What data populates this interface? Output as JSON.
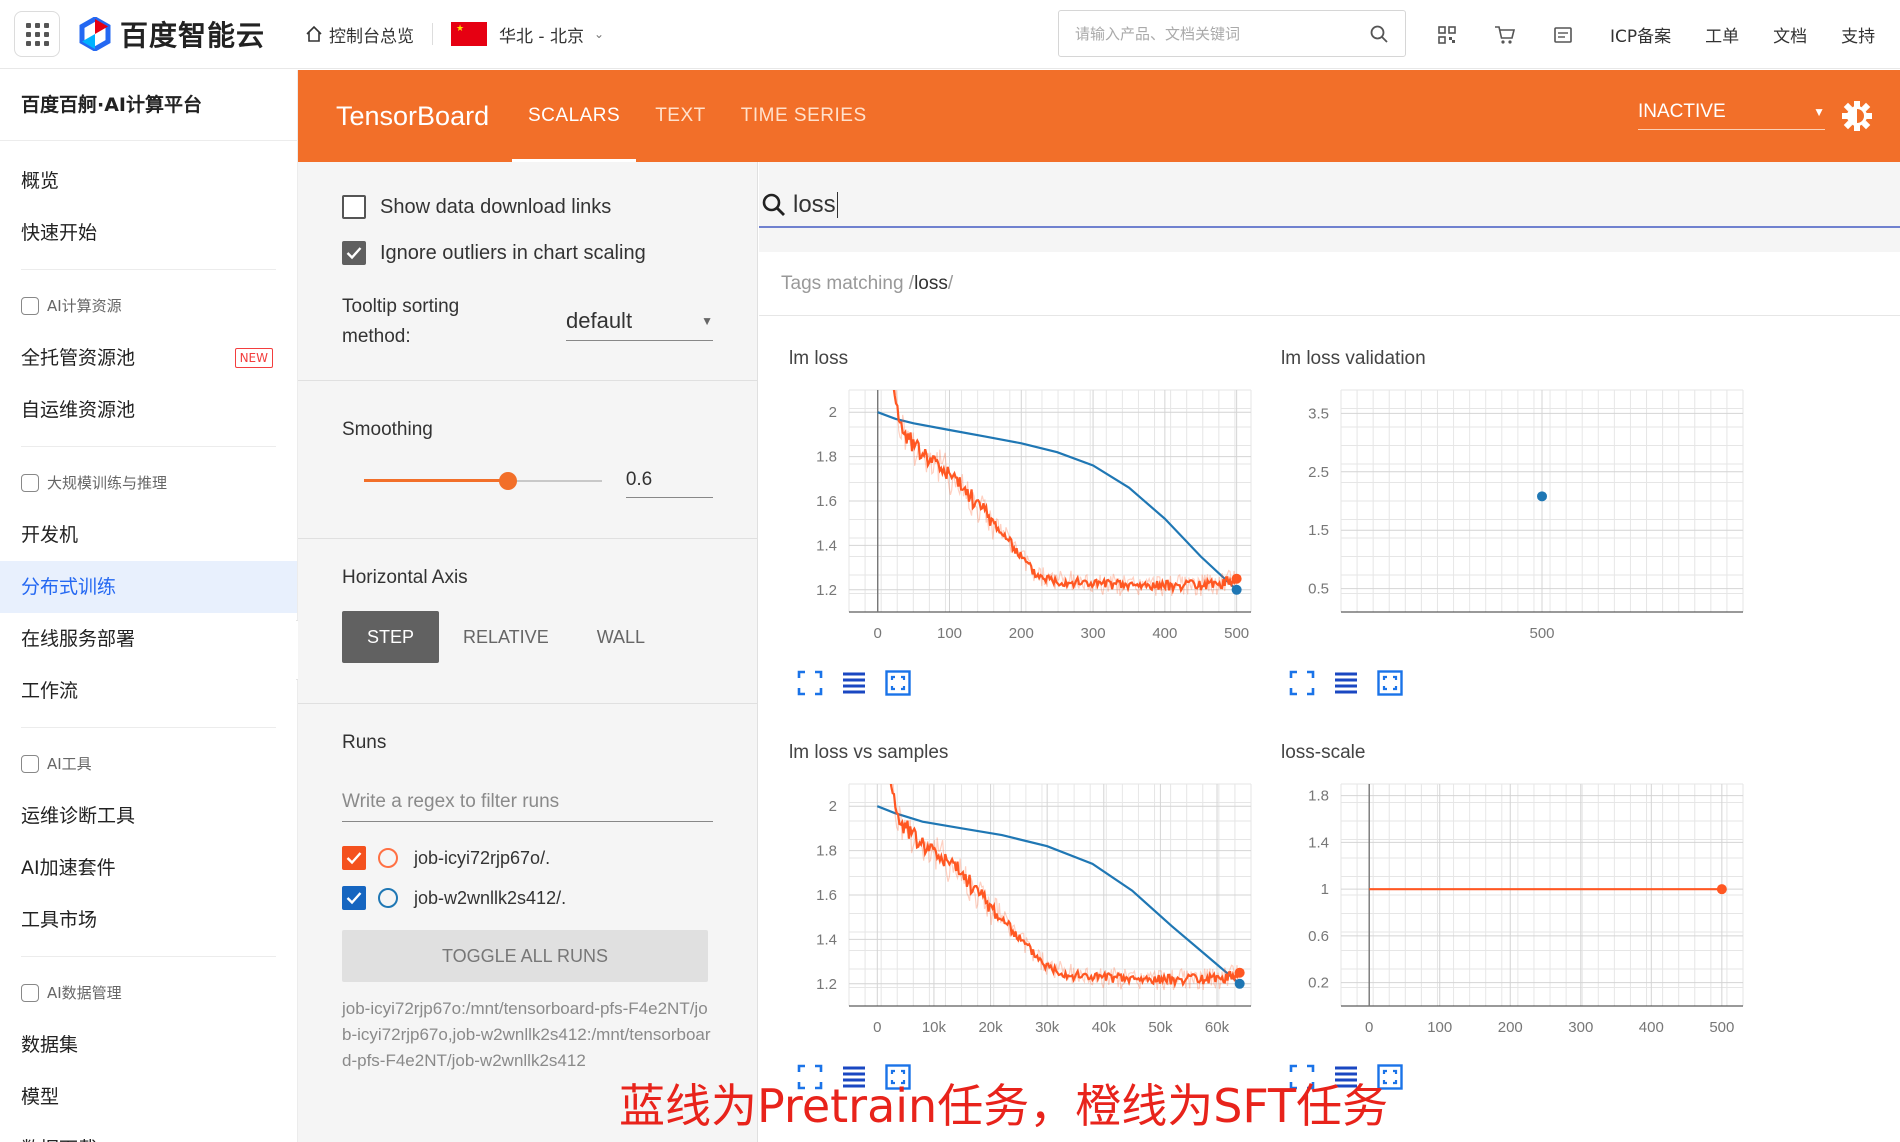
{
  "topbar": {
    "brand": "百度智能云",
    "console": "控制台总览",
    "region": "华北 - 北京",
    "search_placeholder": "请输入产品、文档关键词",
    "links": [
      "ICP备案",
      "工单",
      "文档",
      "支持"
    ],
    "icons": [
      "qrcode-icon",
      "cart-icon",
      "message-icon"
    ]
  },
  "sidebar": {
    "title": "百度百舸·AI计算平台",
    "items_top": [
      "概览",
      "快速开始"
    ],
    "group1": "AI计算资源",
    "group1_items": [
      "全托管资源池",
      "自运维资源池"
    ],
    "new_badge": "NEW",
    "group2": "大规模训练与推理",
    "group2_items": [
      "开发机",
      "分布式训练",
      "在线服务部署",
      "工作流"
    ],
    "active": "分布式训练",
    "group3": "AI工具",
    "group3_items": [
      "运维诊断工具",
      "AI加速套件",
      "工具市场"
    ],
    "group4": "AI数据管理",
    "group4_items": [
      "数据集",
      "模型",
      "数据下载"
    ]
  },
  "tensorboard": {
    "logo": "TensorBoard",
    "tabs": [
      "SCALARS",
      "TEXT",
      "TIME SERIES"
    ],
    "active_tab": "SCALARS",
    "status": "INACTIVE"
  },
  "settings": {
    "show_download_links": "Show data download links",
    "show_download_links_checked": false,
    "ignore_outliers": "Ignore outliers in chart scaling",
    "ignore_outliers_checked": true,
    "tooltip_sorting_label": "Tooltip sorting method:",
    "tooltip_sorting_value": "default",
    "smoothing_label": "Smoothing",
    "smoothing_value": "0.6",
    "smoothing_fraction": 0.6,
    "horizontal_axis_label": "Horizontal Axis",
    "axis_options": [
      "STEP",
      "RELATIVE",
      "WALL"
    ],
    "axis_active": "STEP",
    "runs_label": "Runs",
    "runs_filter_placeholder": "Write a regex to filter runs",
    "runs": [
      {
        "name": "job-icyi72rjp67o/.",
        "color": "#ff7043",
        "checked": true
      },
      {
        "name": "job-w2wnllk2s412/.",
        "color": "#1f77b4",
        "checked": true
      }
    ],
    "toggle_all": "TOGGLE ALL RUNS",
    "run_paths": "job-icyi72rjp67o:/mnt/tensorboard-pfs-F4e2NT/job-icyi72rjp67o,job-w2wnllk2s412:/mnt/tensorboard-pfs-F4e2NT/job-w2wnllk2s412"
  },
  "main": {
    "filter_value": "loss",
    "tags_prefix": "Tags matching /",
    "tags_match": "loss",
    "tags_suffix": "/"
  },
  "colors": {
    "accent": "#f26f29",
    "pretrain": "#1f77b4",
    "sft": "#ff5722"
  },
  "caption": "蓝线为Pretrain任务，橙线为SFT任务",
  "chart_data": [
    {
      "id": "lm-loss",
      "type": "line",
      "title": "lm loss",
      "xlim": [
        -40,
        520
      ],
      "ylim": [
        1.1,
        2.1
      ],
      "xticks": [
        0,
        100,
        200,
        300,
        400,
        500
      ],
      "yticks": [
        1.2,
        1.4,
        1.6,
        1.8,
        2
      ],
      "ytick_labels": [
        "1.2",
        "1.4",
        "1.6",
        "1.8",
        "2"
      ],
      "vline": 0,
      "series": [
        {
          "name": "job-w2wnllk2s412/.",
          "color": "#1f77b4",
          "x": [
            0,
            25,
            50,
            100,
            150,
            200,
            250,
            300,
            350,
            400,
            450,
            500
          ],
          "y": [
            2.0,
            1.97,
            1.95,
            1.92,
            1.89,
            1.86,
            1.82,
            1.76,
            1.66,
            1.52,
            1.35,
            1.2
          ]
        },
        {
          "name": "job-icyi72rjp67o/.",
          "color": "#ff5722",
          "noisy": true,
          "x": [
            20,
            30,
            50,
            100,
            150,
            200,
            220,
            250,
            300,
            350,
            400,
            450,
            480,
            500
          ],
          "y": [
            2.2,
            1.95,
            1.85,
            1.72,
            1.55,
            1.35,
            1.27,
            1.24,
            1.23,
            1.22,
            1.22,
            1.22,
            1.23,
            1.25
          ]
        }
      ]
    },
    {
      "id": "lm-loss-validation",
      "type": "scatter",
      "title": "lm loss validation",
      "xlim": [
        460,
        540
      ],
      "ylim": [
        0.1,
        3.9
      ],
      "xticks": [
        500
      ],
      "yticks": [
        0.5,
        1.5,
        2.5,
        3.5
      ],
      "ytick_labels": [
        "0.5",
        "1.5",
        "2.5",
        "3.5"
      ],
      "series": [
        {
          "name": "job-w2wnllk2s412/.",
          "color": "#1f77b4",
          "x": [
            500
          ],
          "y": [
            2.08
          ]
        }
      ]
    },
    {
      "id": "lm-loss-vs-samples",
      "type": "line",
      "title": "lm loss vs samples",
      "xlim": [
        -5000,
        66000
      ],
      "ylim": [
        1.1,
        2.1
      ],
      "xticks": [
        0,
        10000,
        20000,
        30000,
        40000,
        50000,
        60000
      ],
      "xtick_labels": [
        "0",
        "10k",
        "20k",
        "30k",
        "40k",
        "50k",
        "60k"
      ],
      "yticks": [
        1.2,
        1.4,
        1.6,
        1.8,
        2
      ],
      "ytick_labels": [
        "1.2",
        "1.4",
        "1.6",
        "1.8",
        "2"
      ],
      "series": [
        {
          "name": "job-w2wnllk2s412/.",
          "color": "#1f77b4",
          "x": [
            0,
            3000,
            8000,
            15000,
            22000,
            30000,
            38000,
            45000,
            52000,
            58000,
            64000
          ],
          "y": [
            2.0,
            1.97,
            1.93,
            1.9,
            1.87,
            1.82,
            1.74,
            1.62,
            1.46,
            1.33,
            1.2
          ]
        },
        {
          "name": "job-icyi72rjp67o/.",
          "color": "#ff5722",
          "noisy": true,
          "x": [
            2000,
            3500,
            7000,
            14000,
            20000,
            26000,
            30000,
            34000,
            40000,
            46000,
            52000,
            58000,
            62000,
            64000
          ],
          "y": [
            2.2,
            1.95,
            1.85,
            1.72,
            1.55,
            1.38,
            1.28,
            1.24,
            1.23,
            1.22,
            1.22,
            1.22,
            1.23,
            1.25
          ]
        }
      ]
    },
    {
      "id": "loss-scale",
      "type": "line",
      "title": "loss-scale",
      "xlim": [
        -40,
        530
      ],
      "ylim": [
        0,
        1.9
      ],
      "xticks": [
        0,
        100,
        200,
        300,
        400,
        500
      ],
      "yticks": [
        0.2,
        0.6,
        1,
        1.4,
        1.8
      ],
      "ytick_labels": [
        "0.2",
        "0.6",
        "1",
        "1.4",
        "1.8"
      ],
      "vline": 0,
      "series": [
        {
          "name": "job-icyi72rjp67o/.",
          "color": "#ff5722",
          "x": [
            0,
            500
          ],
          "y": [
            1,
            1
          ]
        }
      ]
    }
  ]
}
